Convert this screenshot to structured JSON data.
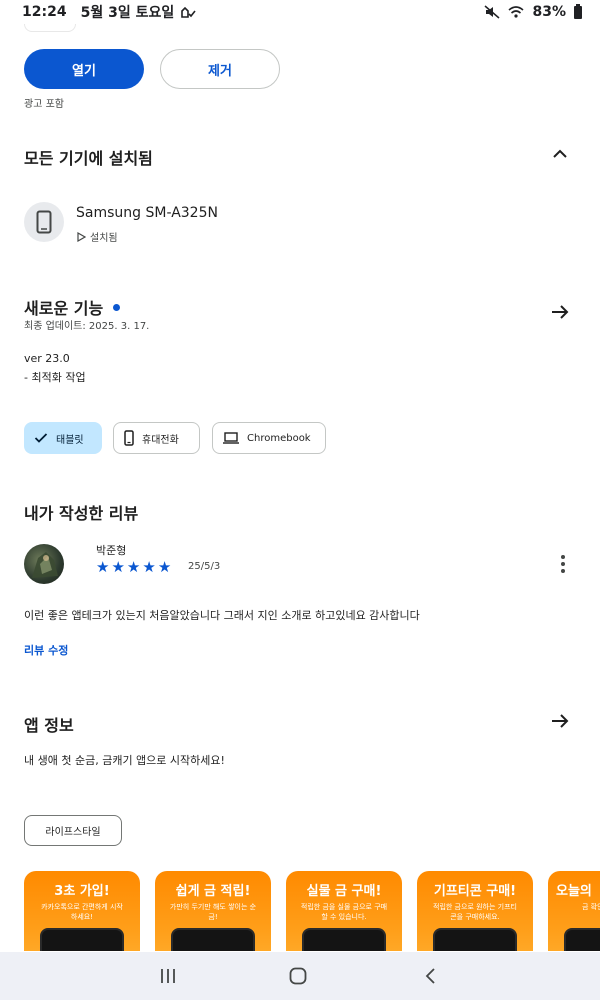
{
  "status_bar": {
    "time": "12:24",
    "date": "5월 3일 토요일",
    "battery": "83%",
    "icons": [
      "cloud-check-icon",
      "mute-icon",
      "wifi-icon",
      "battery-icon"
    ]
  },
  "actions": {
    "open_label": "열기",
    "remove_label": "제거",
    "ads_note": "광고 포함"
  },
  "installed": {
    "title": "모든 기기에 설치됨",
    "device_name": "Samsung SM-A325N",
    "device_status": "설치됨"
  },
  "whats_new": {
    "title": "새로운 기능",
    "updated": "최종 업데이트: 2025. 3. 17.",
    "version": "ver 23.0",
    "notes": "- 최적화 작업"
  },
  "device_chips": [
    {
      "label": "태블릿",
      "selected": true,
      "icon": "check-icon"
    },
    {
      "label": "휴대전화",
      "selected": false,
      "icon": "phone-icon"
    },
    {
      "label": "Chromebook",
      "selected": false,
      "icon": "laptop-icon"
    }
  ],
  "my_review": {
    "title": "내가 작성한 리뷰",
    "reviewer": "박준형",
    "rating": 5,
    "date": "25/5/3",
    "text": "이런 좋은 앱테크가 있는지 처음알았습니다 그래서 지인 소개로 하고있네요 감사합니다",
    "edit_label": "리뷰 수정"
  },
  "app_info": {
    "title": "앱 정보",
    "description": "내 생애 첫 순금, 금캐기 앱으로 시작하세요!",
    "category": "라이프스타일"
  },
  "screenshots": [
    {
      "title": "3초 가입!",
      "subtitle": "카카오톡으로 간편하게 시작하세요!"
    },
    {
      "title": "쉽게 금 적립!",
      "subtitle": "가만히 두기만 해도 쌓이는 순금!"
    },
    {
      "title": "실물 금 구매!",
      "subtitle": "적립한 금을 실물 금으로 구매 할 수 있습니다."
    },
    {
      "title": "기프티콘 구매!",
      "subtitle": "적립한 금으로 원하는 기프티콘을 구매하세요."
    },
    {
      "title": "오늘의",
      "subtitle": "금 확인"
    }
  ],
  "colors": {
    "accent": "#0b57d0",
    "chip_selected": "#c2e7ff",
    "screenshot_orange": "#ff8a00",
    "nav_bg": "#eef0f6"
  }
}
